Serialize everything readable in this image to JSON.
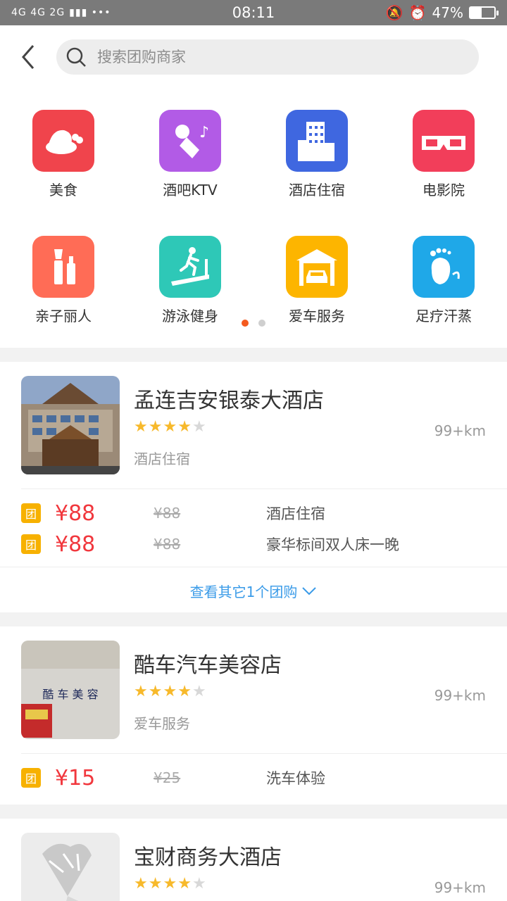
{
  "status": {
    "network": "4G 4G 2G",
    "time": "08:11",
    "battery": "47%",
    "battery_level": 0.47
  },
  "search": {
    "placeholder": "搜索团购商家"
  },
  "categories": [
    {
      "label": "美食",
      "icon": "food-icon",
      "color": "#f0444c"
    },
    {
      "label": "酒吧KTV",
      "icon": "microphone-icon",
      "color": "#b25be6"
    },
    {
      "label": "酒店住宿",
      "icon": "hotel-icon",
      "color": "#3f67e0"
    },
    {
      "label": "电影院",
      "icon": "3d-glasses-icon",
      "color": "#f23e5a"
    },
    {
      "label": "亲子丽人",
      "icon": "cosmetics-icon",
      "color": "#ff6c56"
    },
    {
      "label": "游泳健身",
      "icon": "treadmill-icon",
      "color": "#2ec8b7"
    },
    {
      "label": "爱车服务",
      "icon": "car-garage-icon",
      "color": "#fdb500"
    },
    {
      "label": "足疗汗蒸",
      "icon": "footprint-icon",
      "color": "#1fa8e8"
    }
  ],
  "pager": {
    "pages": 2,
    "active": 0
  },
  "shops": [
    {
      "name": "孟连吉安银泰大酒店",
      "rating": 4,
      "distance": "99+km",
      "category": "酒店住宿",
      "deals": [
        {
          "badge": "团",
          "price": "¥88",
          "original": "¥88",
          "name": "酒店住宿"
        },
        {
          "badge": "团",
          "price": "¥88",
          "original": "¥88",
          "name": "豪华标间双人床一晚"
        }
      ],
      "more": "查看其它1个团购"
    },
    {
      "name": "酷车汽车美容店",
      "rating": 4,
      "distance": "99+km",
      "category": "爱车服务",
      "sign_text": "酷 车 美 容",
      "deals": [
        {
          "badge": "团",
          "price": "¥15",
          "original": "¥25",
          "name": "洗车体验"
        }
      ]
    },
    {
      "name": "宝财商务大酒店",
      "rating": 4,
      "distance": "99+km",
      "category": "",
      "deals": []
    }
  ]
}
